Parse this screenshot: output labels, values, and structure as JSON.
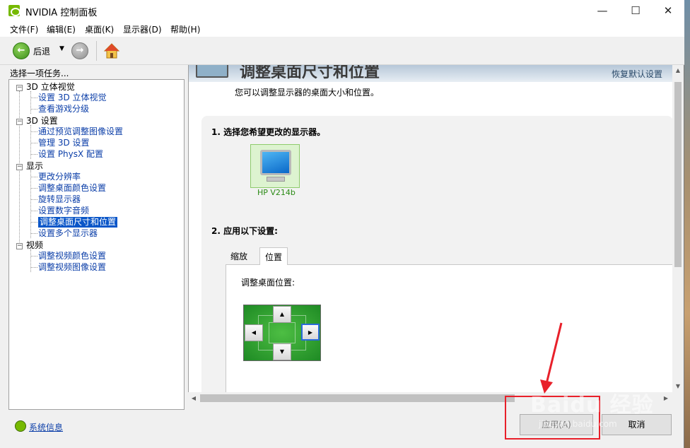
{
  "window": {
    "title": "NVIDIA 控制面板",
    "minimize": "—",
    "maximize": "☐",
    "close": "✕"
  },
  "menu": [
    "文件(F)",
    "编辑(E)",
    "桌面(K)",
    "显示器(D)",
    "帮助(H)"
  ],
  "toolbar": {
    "back_label": "后退",
    "back_arrow": "←",
    "forward_arrow": "→",
    "caret": "▼"
  },
  "left_panel": {
    "task_label": "选择一项任务...",
    "tree": [
      {
        "label": "3D 立体视觉",
        "children": [
          "设置 3D 立体视觉",
          "查看游戏分级"
        ]
      },
      {
        "label": "3D 设置",
        "children": [
          "通过预览调整图像设置",
          "管理 3D 设置",
          "设置 PhysX 配置"
        ]
      },
      {
        "label": "显示",
        "children": [
          "更改分辨率",
          "调整桌面颜色设置",
          "旋转显示器",
          "设置数字音频",
          "调整桌面尺寸和位置",
          "设置多个显示器"
        ]
      },
      {
        "label": "视频",
        "children": [
          "调整视频颜色设置",
          "调整视频图像设置"
        ]
      }
    ],
    "selected": "调整桌面尺寸和位置",
    "tree_box_symbol": "−",
    "sysinfo_link": "系统信息"
  },
  "content": {
    "banner_title": "调整桌面尺寸和位置",
    "restore_link": "恢复默认设置",
    "description": "您可以调整显示器的桌面大小和位置。",
    "step1": "1. 选择您希望更改的显示器。",
    "display_name": "HP V214b",
    "step2": "2. 应用以下设置:",
    "tabs": [
      "缩放",
      "位置"
    ],
    "active_tab": "位置",
    "position_label": "调整桌面位置:",
    "arrows": {
      "up": "▲",
      "down": "▼",
      "left": "◀",
      "right": "▶"
    }
  },
  "scrollbar": {
    "up": "▲",
    "down": "▼",
    "left": "◀",
    "right": "▶"
  },
  "buttons": {
    "apply": "应用(A)",
    "cancel": "取消"
  },
  "watermark": {
    "text": "Baidu 经验",
    "url": "jingyan.baidu.com"
  }
}
